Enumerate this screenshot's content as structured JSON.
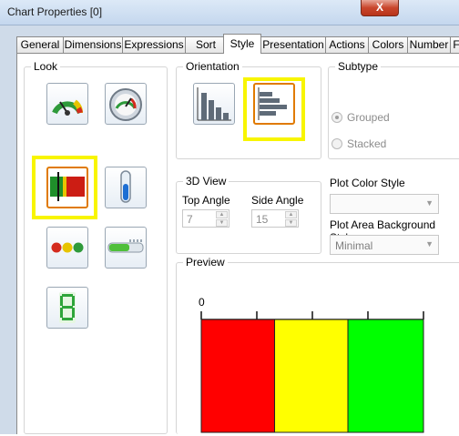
{
  "window": {
    "title": "Chart Properties [0]",
    "close_label": "X"
  },
  "tabs": [
    "General",
    "Dimensions",
    "Expressions",
    "Sort",
    "Style",
    "Presentation",
    "Actions",
    "Colors",
    "Number",
    "F"
  ],
  "active_tab": "Style",
  "look": {
    "title": "Look",
    "icons": [
      "speedometer-gauge-icon",
      "dial-gauge-icon",
      "linear-gauge-icon",
      "thermometer-gauge-icon",
      "traffic-light-icon",
      "led-bar-gauge-icon",
      "digital-digit-icon"
    ],
    "selected": "linear-gauge-icon"
  },
  "orientation": {
    "title": "Orientation",
    "options": [
      "vertical-bars-icon",
      "horizontal-bars-icon"
    ],
    "selected": "horizontal-bars-icon"
  },
  "subtype": {
    "title": "Subtype",
    "grouped_label": "Grouped",
    "stacked_label": "Stacked",
    "selected": "Grouped"
  },
  "view3d": {
    "title": "3D View",
    "top_angle_label": "Top Angle",
    "top_angle_value": "7",
    "side_angle_label": "Side Angle",
    "side_angle_value": "15"
  },
  "plot_color_style": {
    "label": "Plot Color Style",
    "value": ""
  },
  "plot_area_bg": {
    "label": "Plot Area Background Style",
    "value": "Minimal"
  },
  "preview": {
    "title": "Preview",
    "axis_min_label": "0",
    "segments": [
      {
        "color": "#ff0000",
        "share": 0.33
      },
      {
        "color": "#ffff00",
        "share": 0.33
      },
      {
        "color": "#00ff00",
        "share": 0.34
      }
    ],
    "tick_count": 5
  },
  "highlight_color": "#f8f500"
}
